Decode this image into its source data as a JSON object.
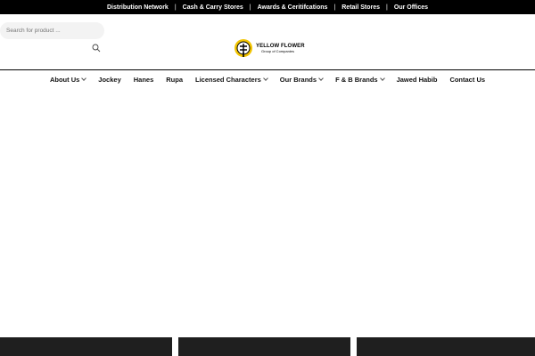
{
  "topbar": {
    "links": [
      "Distribution Network",
      "Cash & Carry Stores",
      "Awards & Ceritifcations",
      "Retail Stores",
      "Our Offices"
    ],
    "separator": "|"
  },
  "search": {
    "placeholder": "Search for product ..."
  },
  "logo": {
    "title": "YELLOW FLOWER",
    "subtitle": "Group of Companies"
  },
  "nav": {
    "items": [
      {
        "label": "About Us",
        "dropdown": true
      },
      {
        "label": "Jockey",
        "dropdown": false
      },
      {
        "label": "Hanes",
        "dropdown": false
      },
      {
        "label": "Rupa",
        "dropdown": false
      },
      {
        "label": "Licensed Characters",
        "dropdown": true
      },
      {
        "label": "Our Brands",
        "dropdown": true
      },
      {
        "label": "F & B Brands",
        "dropdown": true
      },
      {
        "label": "Jawed Habib",
        "dropdown": false
      },
      {
        "label": "Contact Us",
        "dropdown": false
      }
    ]
  },
  "colors": {
    "topbar_bg": "#000000",
    "tile_bg": "#1f1f1f",
    "logo_accent": "#f2c400"
  }
}
